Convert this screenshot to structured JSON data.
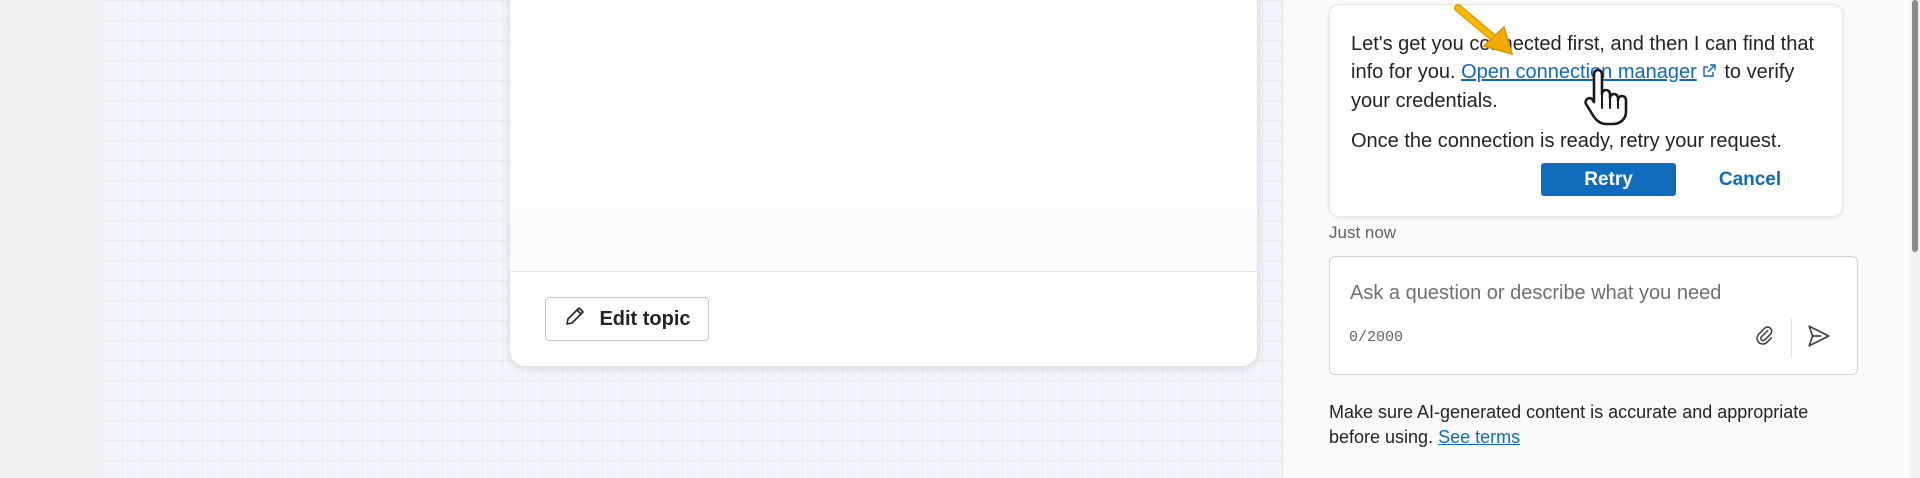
{
  "canvas": {
    "edit_topic_label": "Edit topic",
    "icons": {
      "edit": "pencil-icon"
    }
  },
  "chat": {
    "message": {
      "text_before_link": "Let's get you connected first, and then I can find that info for you.",
      "link_label": "Open connection manager",
      "text_after_link": "to verify your credentials.",
      "text_second": "Once the connection is ready, retry your request.",
      "retry_label": "Retry",
      "cancel_label": "Cancel",
      "icons": {
        "link": "external-link-icon"
      }
    },
    "timestamp": "Just now",
    "input": {
      "placeholder": "Ask a question or describe what you need",
      "value": "",
      "counter": "0/2000",
      "icons": {
        "attach": "paperclip-icon",
        "send": "send-icon"
      }
    },
    "disclaimer": {
      "text": "Make sure AI-generated content is accurate and appropriate before using.",
      "link_label": "See terms"
    }
  },
  "overlay": {
    "icons": {
      "arrow": "arrow-icon",
      "cursor": "hand-cursor-icon"
    }
  },
  "colors": {
    "accent": "#0f6cbd",
    "arrow": "#f2a900",
    "text": "#242424"
  }
}
